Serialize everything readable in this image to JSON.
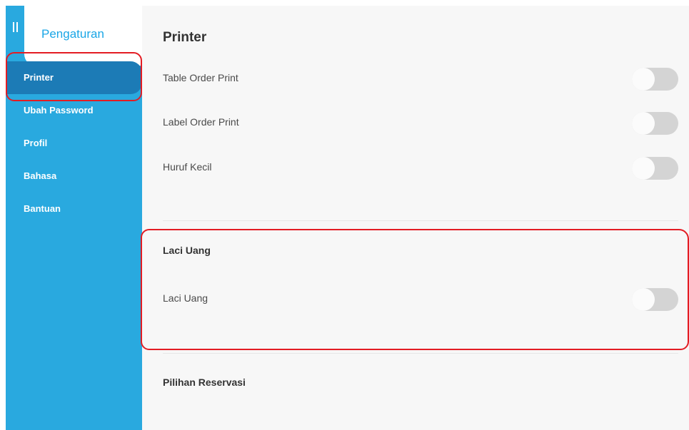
{
  "sidebar": {
    "title": "Pengaturan",
    "items": [
      {
        "label": "Printer"
      },
      {
        "label": "Ubah Password"
      },
      {
        "label": "Profil"
      },
      {
        "label": "Bahasa"
      },
      {
        "label": "Bantuan"
      }
    ]
  },
  "main": {
    "title": "Printer",
    "printer_settings": [
      {
        "label": "Table Order Print",
        "enabled": false
      },
      {
        "label": "Label Order Print",
        "enabled": false
      },
      {
        "label": "Huruf Kecil",
        "enabled": false
      }
    ],
    "cash_drawer": {
      "section_title": "Laci Uang",
      "setting": {
        "label": "Laci Uang",
        "enabled": false
      }
    },
    "reservation": {
      "section_title": "Pilihan Reservasi"
    }
  },
  "colors": {
    "sidebar": "#29a9df",
    "sidebar_active": "#1c7bb6",
    "brand_text": "#1aa6e6",
    "highlight": "#e31c23"
  }
}
